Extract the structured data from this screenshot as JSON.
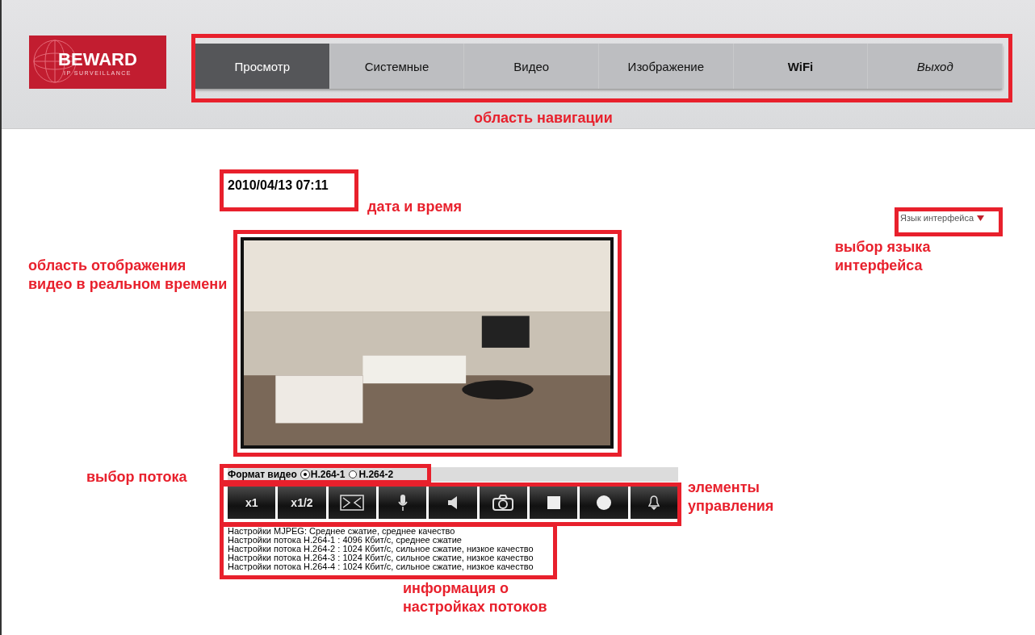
{
  "logo": {
    "brand": "BEWARD",
    "tagline": "IP SURVEILLANCE"
  },
  "nav": [
    {
      "label": "Просмотр",
      "selected": true,
      "kind": "plain"
    },
    {
      "label": "Системные",
      "selected": false,
      "kind": "plain"
    },
    {
      "label": "Видео",
      "selected": false,
      "kind": "plain"
    },
    {
      "label": "Изображение",
      "selected": false,
      "kind": "plain"
    },
    {
      "label": "WiFi",
      "selected": false,
      "kind": "strong"
    },
    {
      "label": "Выход",
      "selected": false,
      "kind": "italic"
    }
  ],
  "datetime": "2010/04/13 07:11",
  "language_selector": {
    "label": "Язык интерфейса"
  },
  "video_format": {
    "label": "Формат видео",
    "options": [
      {
        "label": "H.264-1",
        "selected": true
      },
      {
        "label": "H.264-2",
        "selected": false
      }
    ]
  },
  "controls": [
    {
      "kind": "text",
      "label": "x1"
    },
    {
      "kind": "text",
      "label": "x1/2"
    },
    {
      "kind": "fullscreen"
    },
    {
      "kind": "mic"
    },
    {
      "kind": "sound"
    },
    {
      "kind": "snapshot"
    },
    {
      "kind": "stop"
    },
    {
      "kind": "record"
    },
    {
      "kind": "alarm"
    }
  ],
  "stream_info": [
    "Настройки MJPEG: Среднее сжатие, среднее качество",
    "Настройки потока H.264-1 : 4096 Кбит/с, среднее сжатие",
    "Настройки потока H.264-2 : 1024 Кбит/с, сильное сжатие, низкое качество",
    "Настройки потока H.264-3 : 1024 Кбит/с, сильное сжатие, низкое качество",
    "Настройки потока H.264-4 : 1024 Кбит/с, сильное сжатие, низкое качество"
  ],
  "annotations": [
    "область навигации",
    "дата и время",
    "область отображения видео в реальном времени",
    "выбор потока",
    "элементы управления",
    "информация о настройках потоков",
    "выбор языка интерфейса"
  ]
}
